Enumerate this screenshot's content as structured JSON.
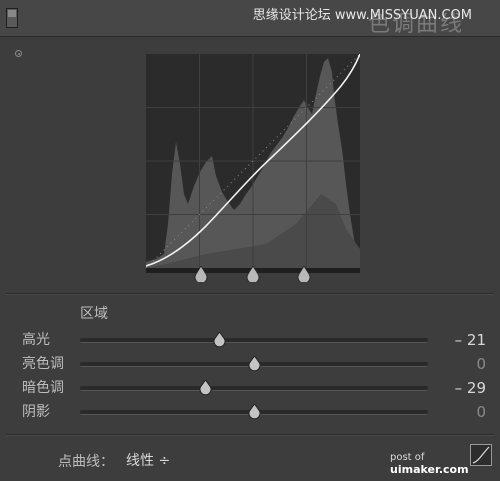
{
  "header": {
    "title": "色调曲线",
    "watermark": "思缘设计论坛 www.MISSYUAN.COM"
  },
  "curve": {
    "grid": true,
    "split_handles": 3
  },
  "region": {
    "label": "区域",
    "sliders": [
      {
        "label": "高光",
        "value": "– 21",
        "position": 0.4,
        "muted": false
      },
      {
        "label": "亮色调",
        "value": "0",
        "position": 0.5,
        "muted": true
      },
      {
        "label": "暗色调",
        "value": "– 29",
        "position": 0.36,
        "muted": false
      },
      {
        "label": "阴影",
        "value": "0",
        "position": 0.5,
        "muted": true
      }
    ]
  },
  "footer": {
    "point_curve_label": "点曲线：",
    "point_curve_value": "线性 ÷",
    "credit_prefix": "post of",
    "credit_site": "uimaker.com",
    "curve_button_icon": "curve-edit-icon"
  },
  "colors": {
    "background": "#3d3d3d",
    "curve": "#ffffff",
    "histogram": "#5c5c5c"
  }
}
